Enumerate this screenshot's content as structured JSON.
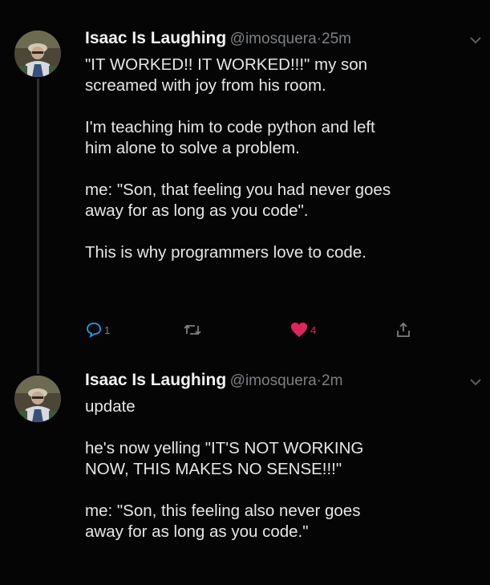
{
  "colors": {
    "background": "#050505",
    "text": "#e6e6e6",
    "muted": "#7c7f83",
    "like": "#e0245e"
  },
  "tweets": [
    {
      "author_name": "Isaac Is Laughing",
      "handle": "@imosquera",
      "separator": "·",
      "time": "25m",
      "paragraphs": [
        "\"IT WORKED!! IT WORKED!!!\" my son\nscreamed with joy from his room.",
        "I'm teaching him to code python and left\nhim alone to solve a problem.",
        "me: \"Son, that feeling you had never goes\naway for as long as you code\".",
        "This is why programmers love to code."
      ],
      "actions": {
        "reply_count": "1",
        "retweet_count": "",
        "like_count": "4",
        "icons": [
          "reply-icon",
          "retweet-icon",
          "heart-icon",
          "share-icon"
        ]
      }
    },
    {
      "author_name": "Isaac Is Laughing",
      "handle": "@imosquera",
      "separator": "·",
      "time": "2m",
      "paragraphs": [
        "update",
        "he's now yelling \"IT'S NOT WORKING\nNOW, THIS MAKES NO SENSE!!!\"",
        "me: \"Son, this feeling also never goes\naway for as long as you code.\""
      ]
    }
  ]
}
